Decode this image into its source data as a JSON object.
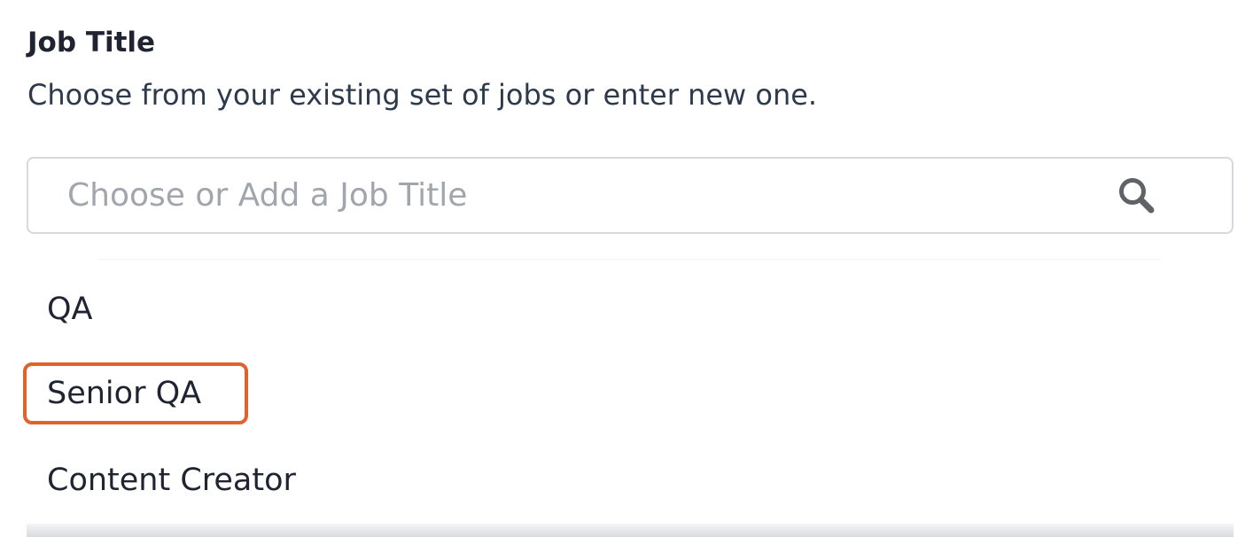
{
  "field": {
    "label": "Job Title",
    "helper_text": "Choose from your existing set of jobs or enter new one."
  },
  "search": {
    "placeholder": "Choose or Add a Job Title",
    "value": "",
    "icon": "search-icon"
  },
  "dropdown": {
    "options": [
      {
        "label": "QA"
      },
      {
        "label": "Senior QA"
      },
      {
        "label": "Content Creator"
      }
    ]
  },
  "annotation": {
    "highlighted_option": "Senior QA",
    "highlight_color": "#e1622b"
  },
  "colors": {
    "label_text": "#1f2430",
    "helper_text": "#2c3a4b",
    "placeholder_text": "#a1a6ad",
    "input_border": "#d6d9de",
    "icon": "#5f6368"
  }
}
